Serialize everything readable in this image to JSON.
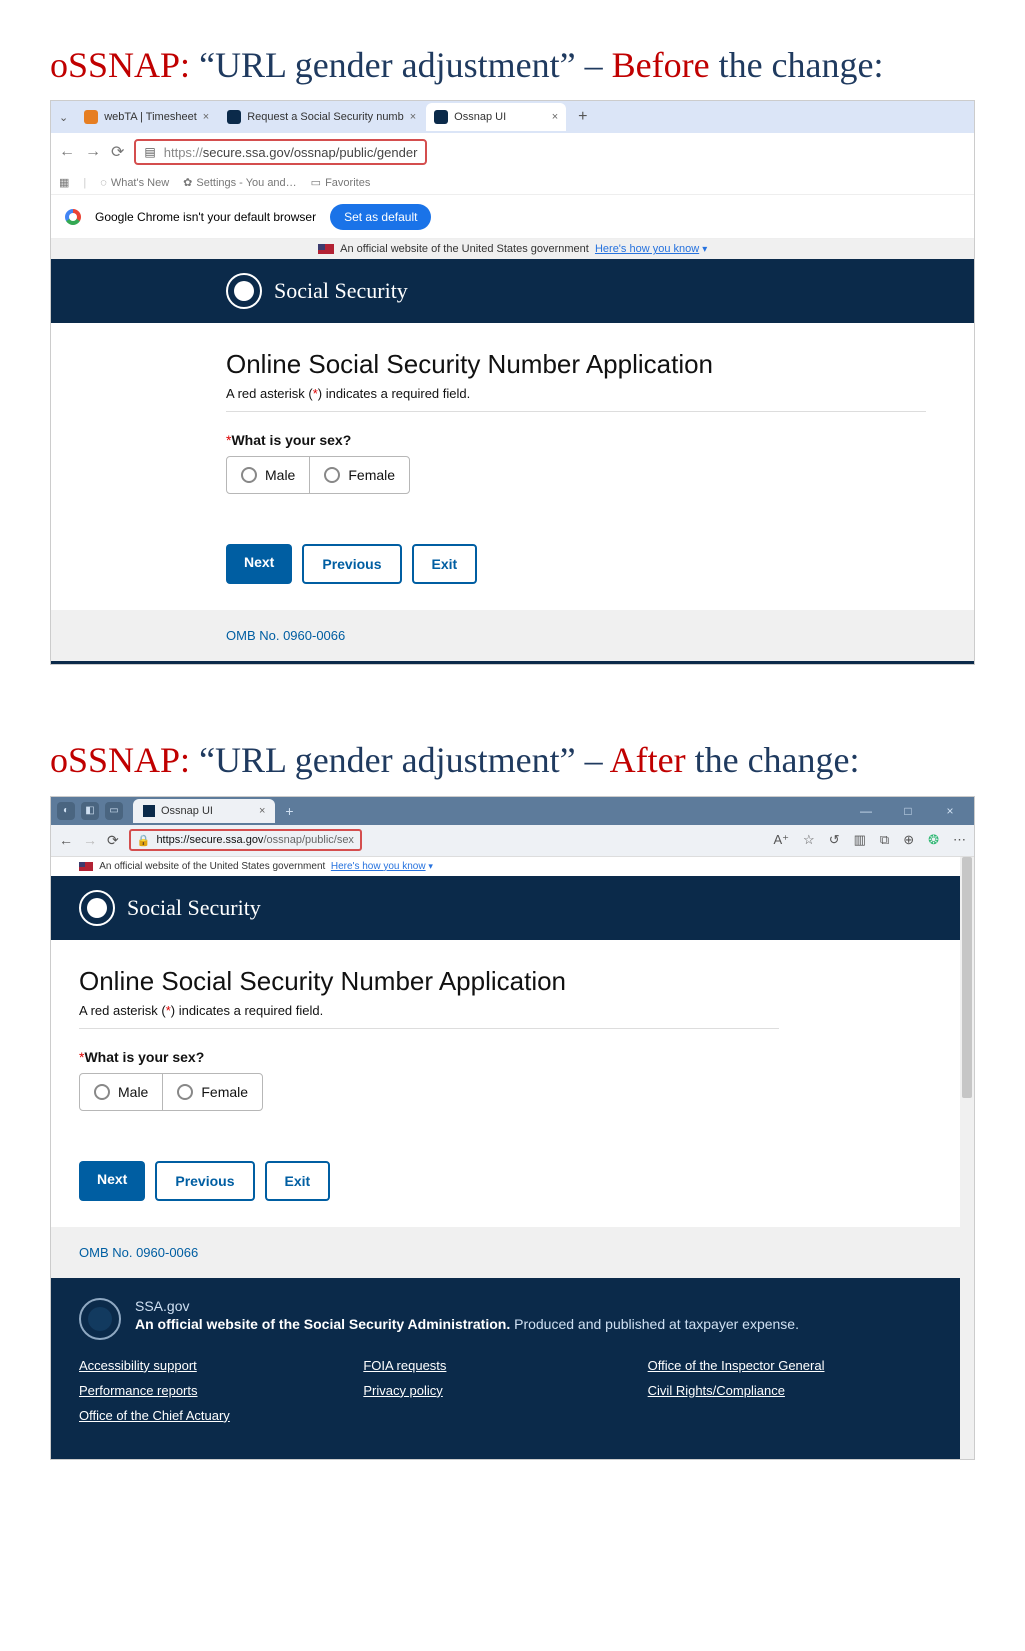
{
  "heading1": {
    "prefix": "oSSNAP:",
    "quoted": "“URL gender adjustment”",
    "dash": " – ",
    "state": "Before",
    "suffix": " the change:"
  },
  "heading2": {
    "prefix": "oSSNAP:",
    "quoted": "“URL gender adjustment”",
    "dash": " – ",
    "state": "After",
    "suffix": " the change:"
  },
  "chrome": {
    "tabs": [
      {
        "title": "webTA | Timesheet",
        "close": "×"
      },
      {
        "title": "Request a Social Security numb",
        "close": "×"
      },
      {
        "title": "Ossnap UI",
        "close": "×"
      }
    ],
    "url_prefix": "https://",
    "url_rest": "secure.ssa.gov/ossnap/public/gender",
    "bookmarks": {
      "whatsnew": "What's New",
      "settings": "Settings - You and…",
      "favorites": "Favorites"
    },
    "default_msg": "Google Chrome isn't your default browser",
    "set_default": "Set as default"
  },
  "gov": {
    "text": "An official website of the United States government",
    "link": "Here's how you know"
  },
  "ssa": {
    "brand": "Social Security"
  },
  "page": {
    "title": "Online Social Security Number Application",
    "req_note_pre": "A red asterisk (",
    "req_ast": "*",
    "req_note_post": ") indicates a required field.",
    "q_ast": "*",
    "q_label": "What is your sex?",
    "opt_male": "Male",
    "opt_female": "Female",
    "btn_next": "Next",
    "btn_prev": "Previous",
    "btn_exit": "Exit",
    "omb": "OMB No. 0960-0066"
  },
  "edge": {
    "tab_title": "Ossnap UI",
    "tab_close": "×",
    "url_first": "https://secure.ssa.gov",
    "url_rest": "/ossnap/public/sex"
  },
  "footer": {
    "domain": "SSA.gov",
    "bold": "An official website of the Social Security Administration.",
    "rest": " Produced and published at taxpayer expense.",
    "col1": [
      "Accessibility support",
      "Performance reports",
      "Office of the Chief Actuary"
    ],
    "col2": [
      "FOIA requests",
      "Privacy policy"
    ],
    "col3": [
      "Office of the Inspector General",
      "Civil Rights/Compliance"
    ]
  }
}
